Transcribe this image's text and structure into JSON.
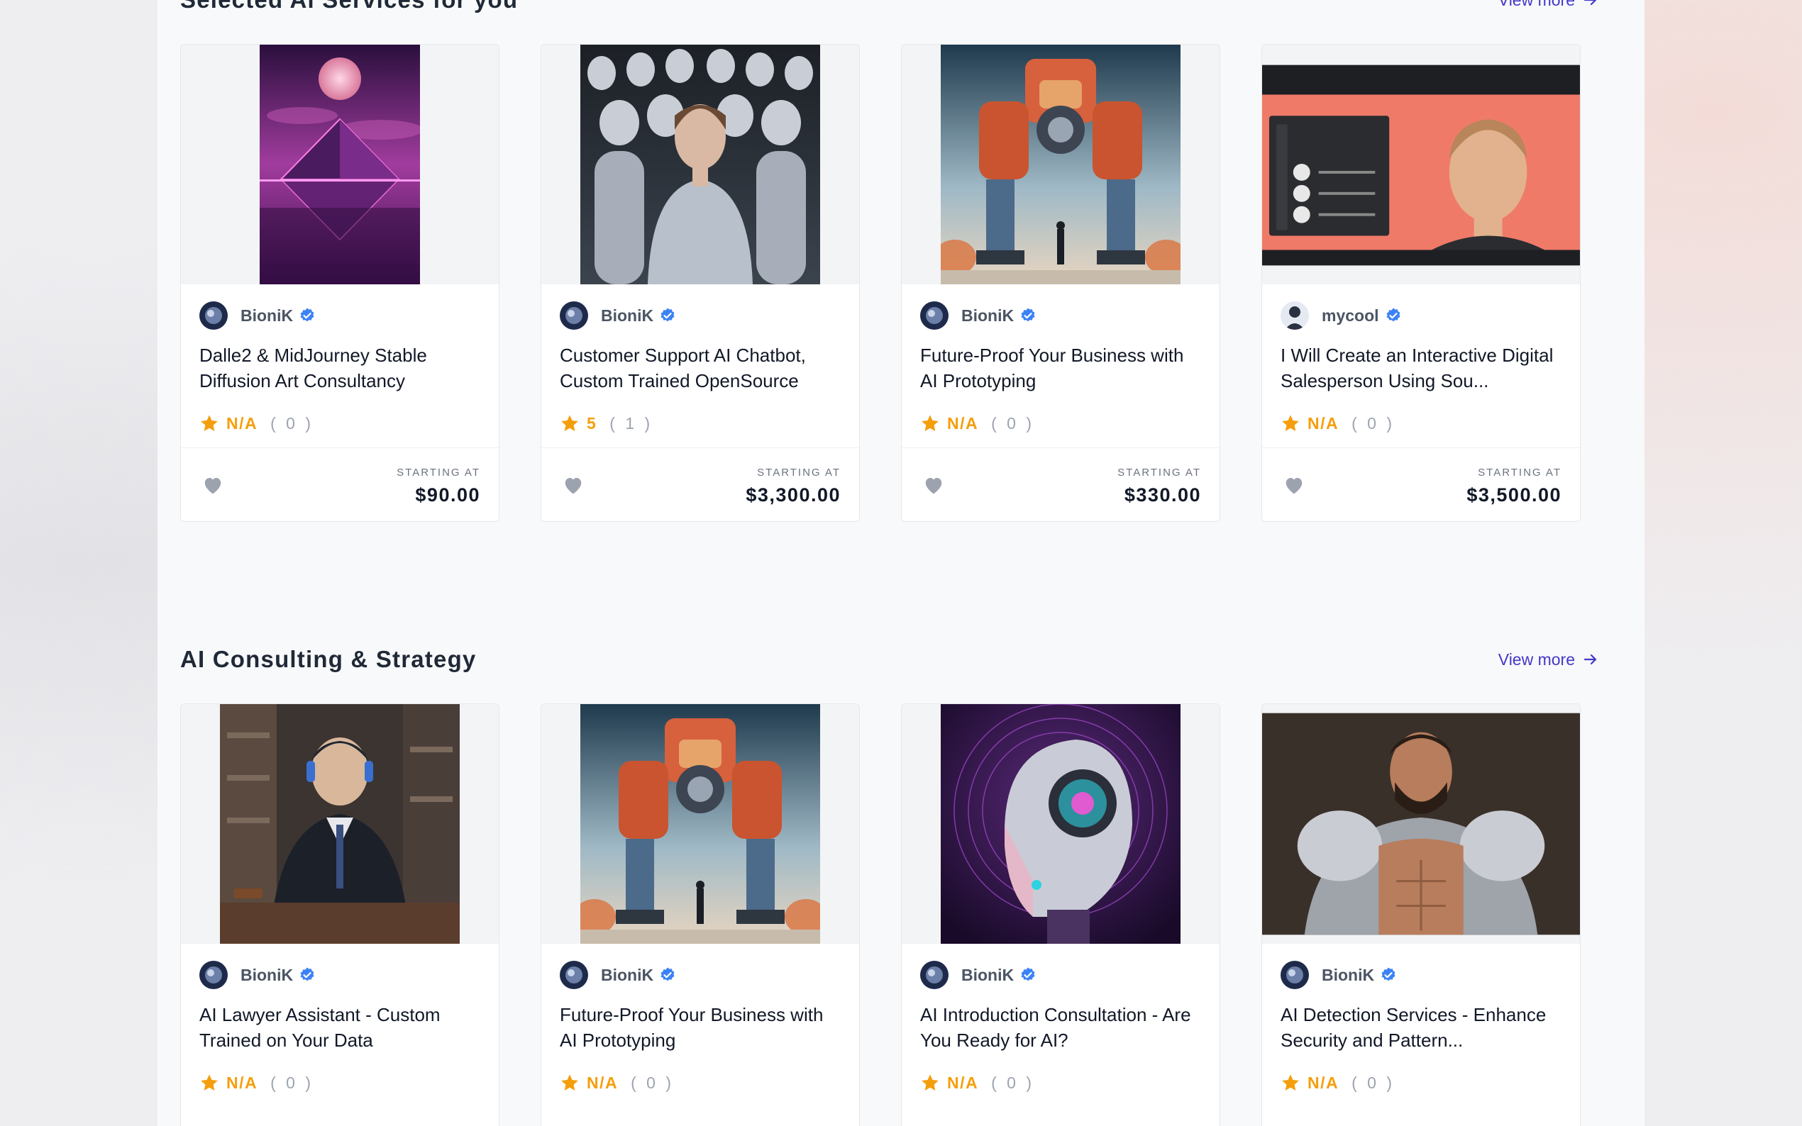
{
  "colors": {
    "accent": "#4338ca",
    "star": "#f59e0b",
    "verified": "#3b82f6",
    "heart": "#9ca3af"
  },
  "icons": {
    "view_more": "arrow-right-icon",
    "verified": "verified-badge-icon",
    "rating": "star-icon",
    "favorite": "heart-icon"
  },
  "sections": [
    {
      "title": "Selected Ai Services for you",
      "view_more": "View more",
      "cards": [
        {
          "seller": "BioniK",
          "title": "Dalle2 & MidJourney Stable Diffusion Art Consultancy",
          "rating": "N/A",
          "count": "( 0 )",
          "starting": "STARTING AT",
          "price": "$90.00"
        },
        {
          "seller": "BioniK",
          "title": "Customer Support AI Chatbot, Custom Trained OpenSource",
          "rating": "5",
          "count": "( 1 )",
          "starting": "STARTING AT",
          "price": "$3,300.00"
        },
        {
          "seller": "BioniK",
          "title": "Future-Proof Your Business with AI Prototyping",
          "rating": "N/A",
          "count": "( 0 )",
          "starting": "STARTING AT",
          "price": "$330.00"
        },
        {
          "seller": "mycool",
          "title": "I Will Create an Interactive Digital Salesperson Using Sou...",
          "rating": "N/A",
          "count": "( 0 )",
          "starting": "STARTING AT",
          "price": "$3,500.00"
        }
      ]
    },
    {
      "title": "AI Consulting & Strategy",
      "view_more": "View more",
      "cards": [
        {
          "seller": "BioniK",
          "title": "AI Lawyer Assistant - Custom Trained on Your Data",
          "rating": "N/A",
          "count": "( 0 )"
        },
        {
          "seller": "BioniK",
          "title": "Future-Proof Your Business with AI Prototyping",
          "rating": "N/A",
          "count": "( 0 )"
        },
        {
          "seller": "BioniK",
          "title": "AI Introduction Consultation - Are You Ready for AI?",
          "rating": "N/A",
          "count": "( 0 )"
        },
        {
          "seller": "BioniK",
          "title": "AI Detection Services - Enhance Security and Pattern...",
          "rating": "N/A",
          "count": "( 0 )"
        }
      ]
    }
  ]
}
